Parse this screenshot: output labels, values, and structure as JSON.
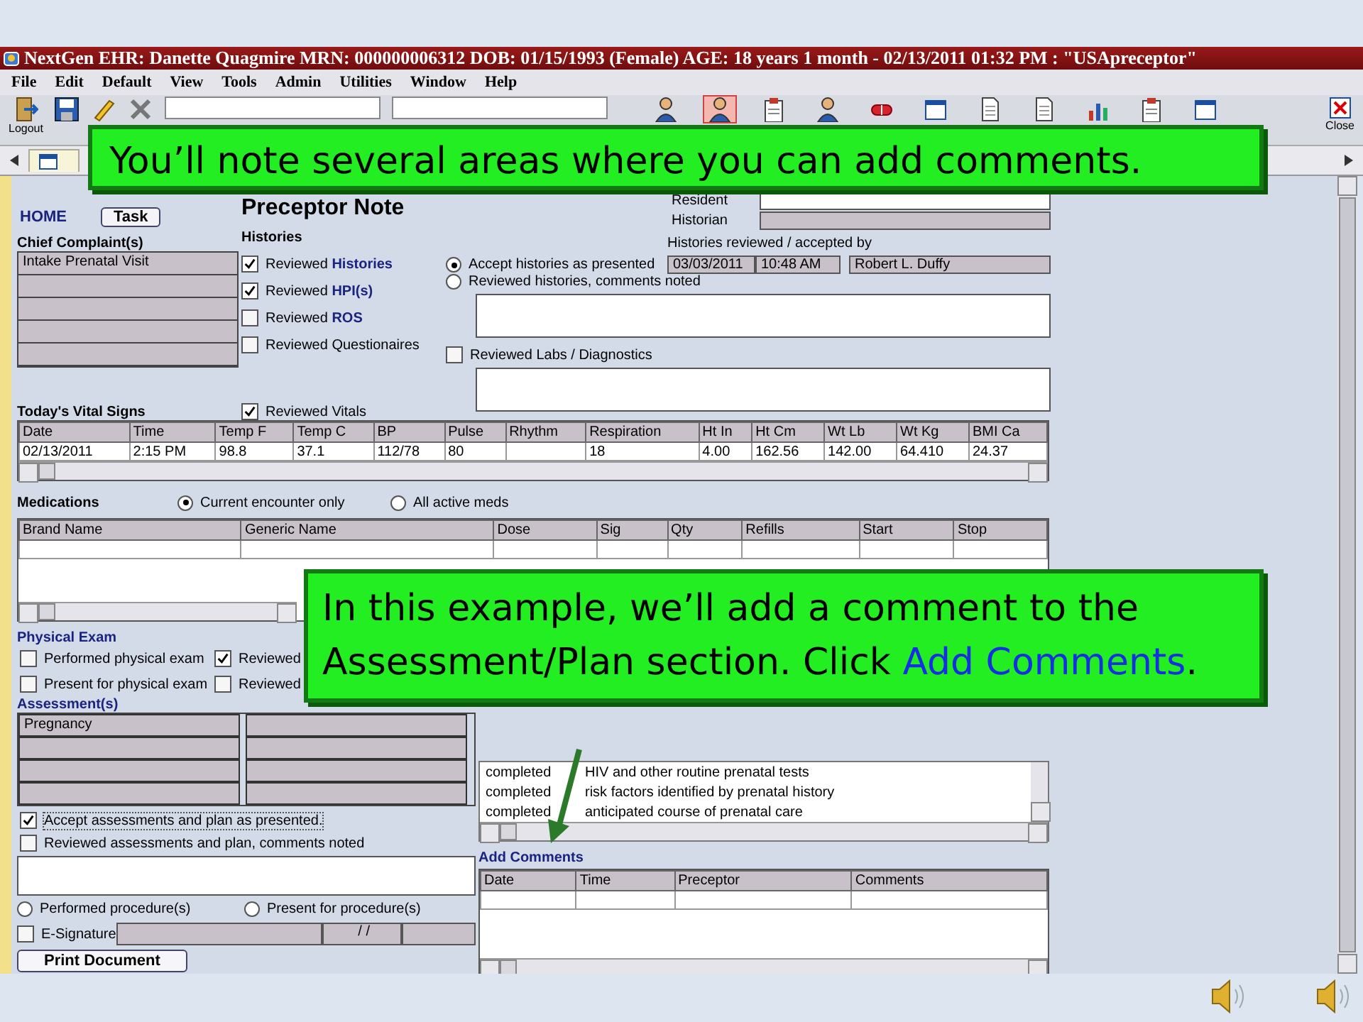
{
  "title_bar": {
    "title": "NextGen EHR: Danette Quagmire  MRN: 000000006312  DOB: 01/15/1993  (Female)  AGE: 18 years 1 month - 02/13/2011 01:32 PM : \"USApreceptor\""
  },
  "menu": [
    "File",
    "Edit",
    "Default",
    "View",
    "Tools",
    "Admin",
    "Utilities",
    "Window",
    "Help"
  ],
  "toolbar": {
    "logout": "Logout",
    "close": "Close",
    "icons": [
      {
        "kind": "person",
        "selected": false
      },
      {
        "kind": "person",
        "selected": true
      },
      {
        "kind": "clipboard",
        "selected": false
      },
      {
        "kind": "person",
        "selected": false
      },
      {
        "kind": "pill",
        "selected": false
      },
      {
        "kind": "window",
        "selected": false
      },
      {
        "kind": "document",
        "selected": false
      },
      {
        "kind": "document",
        "selected": false
      },
      {
        "kind": "chart",
        "selected": false
      },
      {
        "kind": "clipboard",
        "selected": false
      },
      {
        "kind": "window",
        "selected": false
      }
    ]
  },
  "header": {
    "home": "HOME",
    "task": "Task",
    "title": "Preceptor Note"
  },
  "chief_complaints": {
    "label": "Chief Complaint(s)",
    "items": [
      "Intake Prenatal Visit"
    ]
  },
  "histories": {
    "label": "Histories",
    "checks": [
      {
        "label": "Reviewed **Histories**",
        "checked": true
      },
      {
        "label": "Reviewed **HPI(s)**",
        "checked": true
      },
      {
        "label": "Reviewed **ROS**",
        "checked": false
      },
      {
        "label": "Reviewed Questionaires",
        "checked": false
      }
    ]
  },
  "vitals_check": {
    "label": "Reviewed Vitals",
    "checked": true
  },
  "resident": {
    "label": "Resident"
  },
  "historian": {
    "label": "Historian"
  },
  "accepted_by": {
    "label": "Histories reviewed / accepted by",
    "date": "03/03/2011",
    "time": "10:48 AM",
    "name": "Robert L. Duffy"
  },
  "history_options": [
    {
      "label": "Accept histories as presented",
      "selected": true
    },
    {
      "label": "Reviewed histories,  comments noted",
      "selected": false
    }
  ],
  "labs_check": {
    "label": "Reviewed Labs / Diagnostics",
    "checked": false
  },
  "vitals": {
    "label": "Today's Vital Signs",
    "columns": [
      "Date",
      "Time",
      "Temp F",
      "Temp C",
      "BP",
      "Pulse",
      "Rhythm",
      "Respiration",
      "Ht In",
      "Ht Cm",
      "Wt Lb",
      "Wt Kg",
      "BMI Ca"
    ],
    "rows": [
      [
        "02/13/2011",
        "2:15 PM",
        "98.8",
        "37.1",
        "112/78",
        "80",
        "",
        "18",
        "4.00",
        "162.56",
        "142.00",
        "64.410",
        "24.37"
      ]
    ]
  },
  "medications": {
    "label": "Medications",
    "scope": [
      {
        "label": "Current encounter only",
        "selected": true
      },
      {
        "label": "All active meds",
        "selected": false
      }
    ],
    "columns": [
      "Brand Name",
      "Generic Name",
      "Dose",
      "Sig",
      "Qty",
      "Refills",
      "Start",
      "Stop"
    ]
  },
  "physical_exam": {
    "label": "Physical Exam",
    "checks": [
      {
        "label": "Performed physical exam",
        "checked": false
      },
      {
        "label": "Reviewed",
        "checked": true
      },
      {
        "label": "Present for physical exam",
        "checked": false
      },
      {
        "label": "Reviewed",
        "checked": false
      }
    ]
  },
  "assessments": {
    "label": "Assessment(s)",
    "items": [
      "Pregnancy"
    ]
  },
  "plan_checks": [
    {
      "label": "Accept assessments and plan as presented.",
      "checked": true
    },
    {
      "label": "Reviewed assessments and plan, comments noted",
      "checked": false
    }
  ],
  "procedure_options": [
    {
      "label": "Performed procedure(s)",
      "selected": false
    },
    {
      "label": "Present for procedure(s)",
      "selected": false
    }
  ],
  "esignature": {
    "label": "E-Signature",
    "checked": false,
    "date": "/ /"
  },
  "print_button": "Print Document",
  "orders": {
    "rows": [
      [
        "completed",
        "HIV and other routine prenatal tests"
      ],
      [
        "completed",
        "risk factors identified by prenatal history"
      ],
      [
        "completed",
        "anticipated course of prenatal care"
      ]
    ]
  },
  "comments": {
    "label": "Add Comments",
    "columns": [
      "Date",
      "Time",
      "Preceptor",
      "Comments"
    ]
  },
  "callouts": [
    {
      "text": "You’ll note several areas where you can add comments."
    },
    {
      "text": "In this example, we’ll add a comment to the Assessment/Plan section.  Click ",
      "link": "Add Comments",
      "after": "."
    }
  ]
}
